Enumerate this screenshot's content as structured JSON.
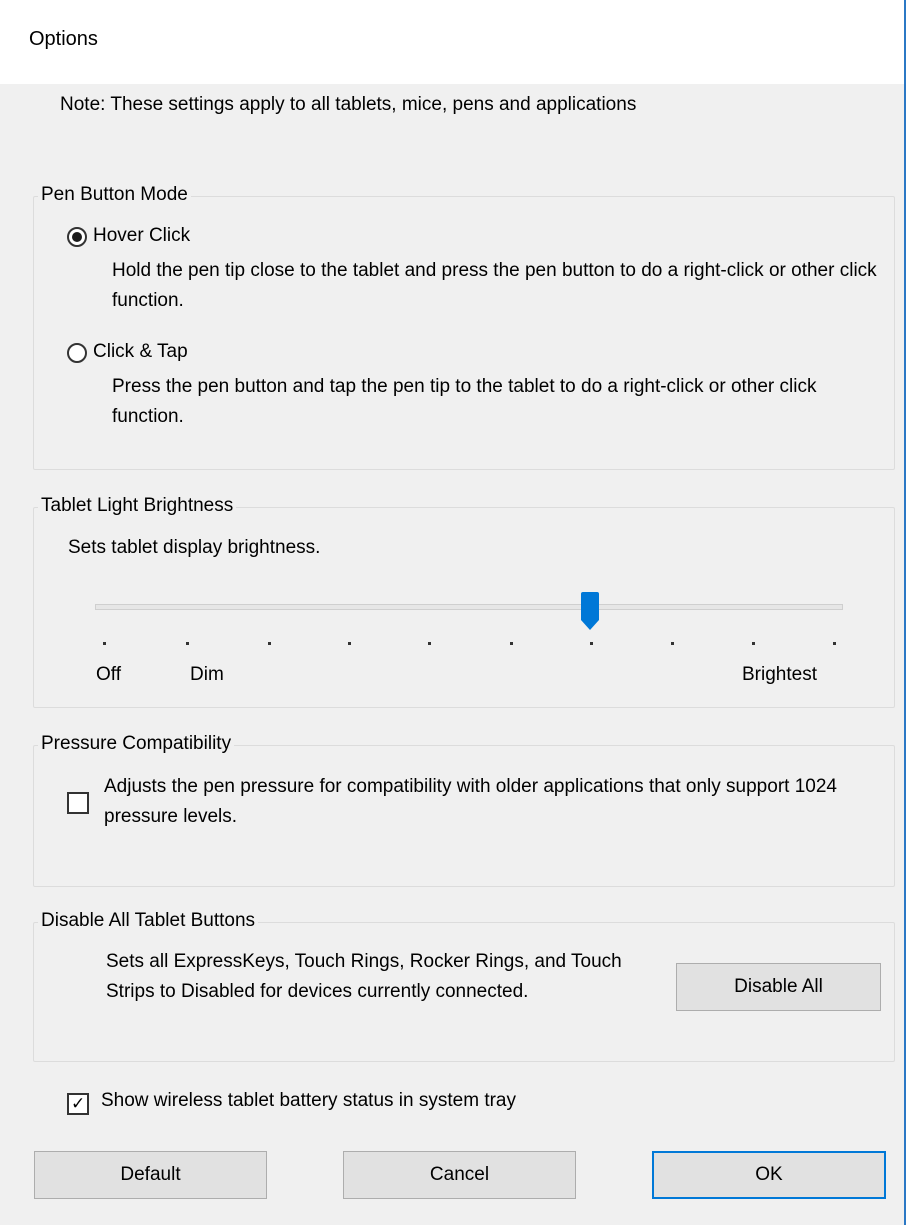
{
  "window": {
    "title": "Options"
  },
  "note": "Note: These settings apply to all tablets, mice, pens and applications",
  "pen_button_mode": {
    "legend": "Pen Button Mode",
    "options": [
      {
        "label": "Hover Click",
        "checked": true,
        "description": "Hold the pen tip close to the tablet and press the pen button to do a right-click or other click function."
      },
      {
        "label": "Click & Tap",
        "checked": false,
        "description": "Press the pen button and tap the pen tip to the tablet to do a right-click or other click function."
      }
    ]
  },
  "tablet_light": {
    "legend": "Tablet Light Brightness",
    "description": "Sets tablet display brightness.",
    "slider": {
      "min_label": "Off",
      "dim_label": "Dim",
      "max_label": "Brightest",
      "tick_count": 10,
      "value_index": 6,
      "thumb_color": "#0078d7"
    }
  },
  "pressure": {
    "legend": "Pressure Compatibility",
    "checkbox_label": "Adjusts the pen pressure for compatibility with older applications that only support 1024 pressure levels.",
    "checked": false
  },
  "disable_buttons": {
    "legend": "Disable All Tablet Buttons",
    "description": "Sets all ExpressKeys, Touch Rings, Rocker Rings, and Touch Strips to Disabled for devices currently connected.",
    "button_label": "Disable All"
  },
  "battery": {
    "label": "Show wireless tablet battery status in system tray",
    "checked": true
  },
  "footer": {
    "default_label": "Default",
    "cancel_label": "Cancel",
    "ok_label": "OK"
  },
  "colors": {
    "accent": "#0078d7",
    "border": "#2b78c5",
    "background": "#f0f0f0"
  }
}
